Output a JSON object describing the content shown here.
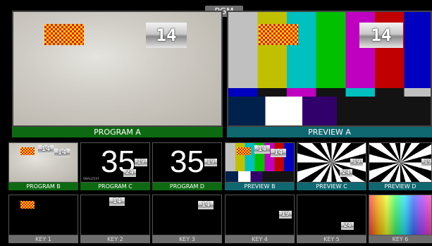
{
  "pgm_badge": "PGM",
  "main": {
    "program": {
      "label": "PROGRAM A",
      "number": "14"
    },
    "preview": {
      "label": "PREVIEW A",
      "number": "14"
    }
  },
  "row2": [
    {
      "label": "PROGRAM B",
      "n1": "14",
      "n2": "14"
    },
    {
      "label": "PROGRAM C",
      "big": "35",
      "n1": "19",
      "n2": "24",
      "tiny": "SMALLTEXT"
    },
    {
      "label": "PROGRAM D",
      "big": "35",
      "n1": "19"
    },
    {
      "label": "PREVIEW B",
      "n1": "14",
      "n2": "14"
    },
    {
      "label": "PREVIEW C",
      "n1": "19",
      "n2": "24"
    },
    {
      "label": "PREVIEW D",
      "n1": "19"
    }
  ],
  "row3": [
    {
      "label": "KEY 1"
    },
    {
      "label": "KEY 2",
      "n1": "14"
    },
    {
      "label": "KEY 3",
      "n1": "14"
    },
    {
      "label": "KEY 4",
      "n1": "19"
    },
    {
      "label": "KEY 5",
      "n1": "24"
    },
    {
      "label": "KEY 6"
    }
  ],
  "colors": {
    "program_label": "#0e6a12",
    "preview_label": "#0f6770",
    "key_label": "#6d6d6d"
  },
  "icons": [
    "checker-pattern-graphic",
    "color-bars-graphic",
    "sunburst-graphic",
    "rainbow-graphic"
  ]
}
